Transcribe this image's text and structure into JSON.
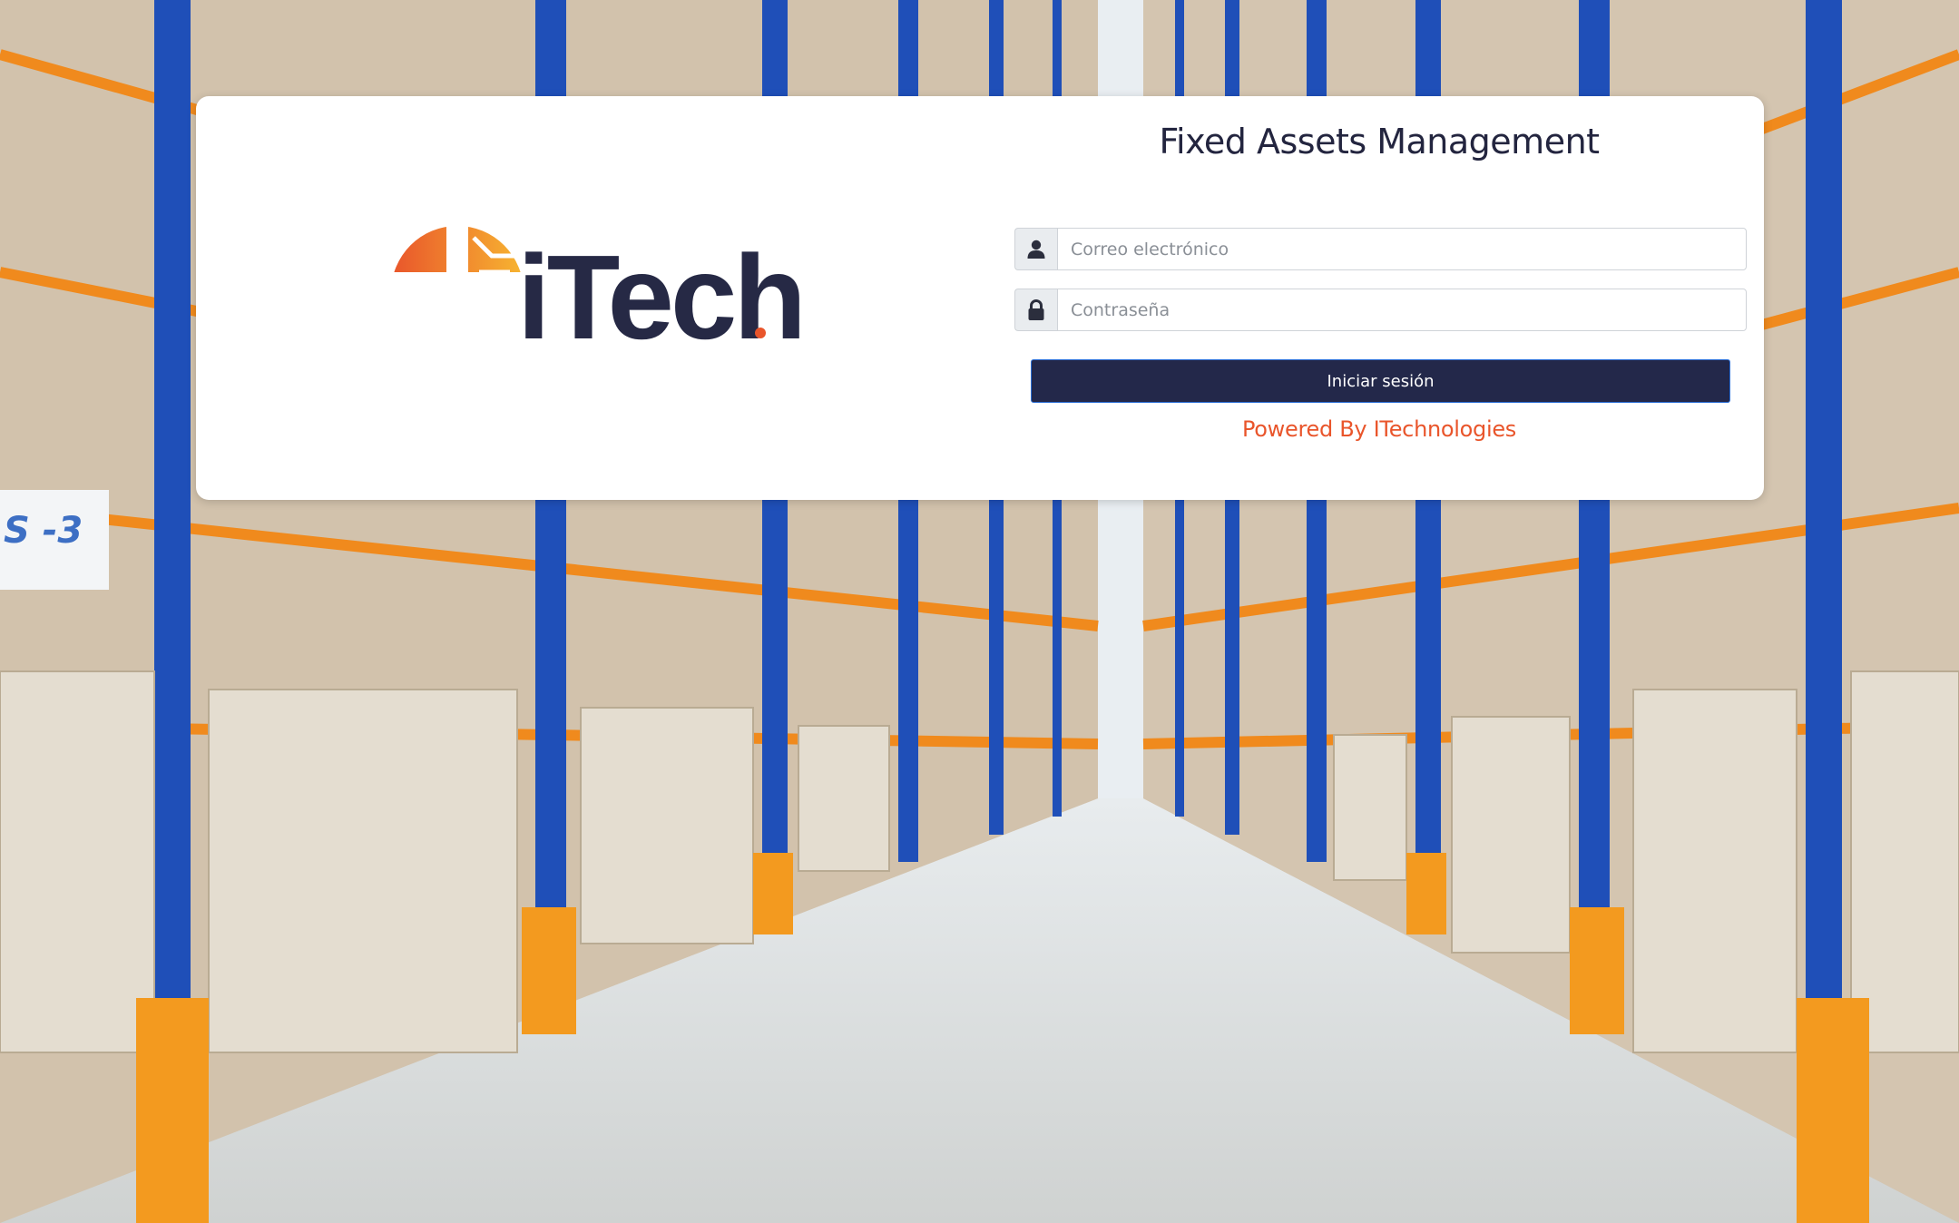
{
  "app": {
    "title": "Fixed Assets Management"
  },
  "logo": {
    "text": "iTech",
    "brand_colors": {
      "orange": "#e9552b",
      "gold": "#f5a623",
      "navy": "#262945"
    }
  },
  "form": {
    "email": {
      "placeholder": "Correo electrónico",
      "value": "",
      "icon": "user-icon"
    },
    "password": {
      "placeholder": "Contraseña",
      "value": "",
      "icon": "lock-icon"
    },
    "submit_label": "Iniciar sesión"
  },
  "footer": {
    "powered_by": "Powered By ITechnologies"
  },
  "background": {
    "description_colors": {
      "rack_blue": "#1f4fb8",
      "rack_orange": "#f08a1d",
      "floor": "#dfe3e5"
    }
  }
}
